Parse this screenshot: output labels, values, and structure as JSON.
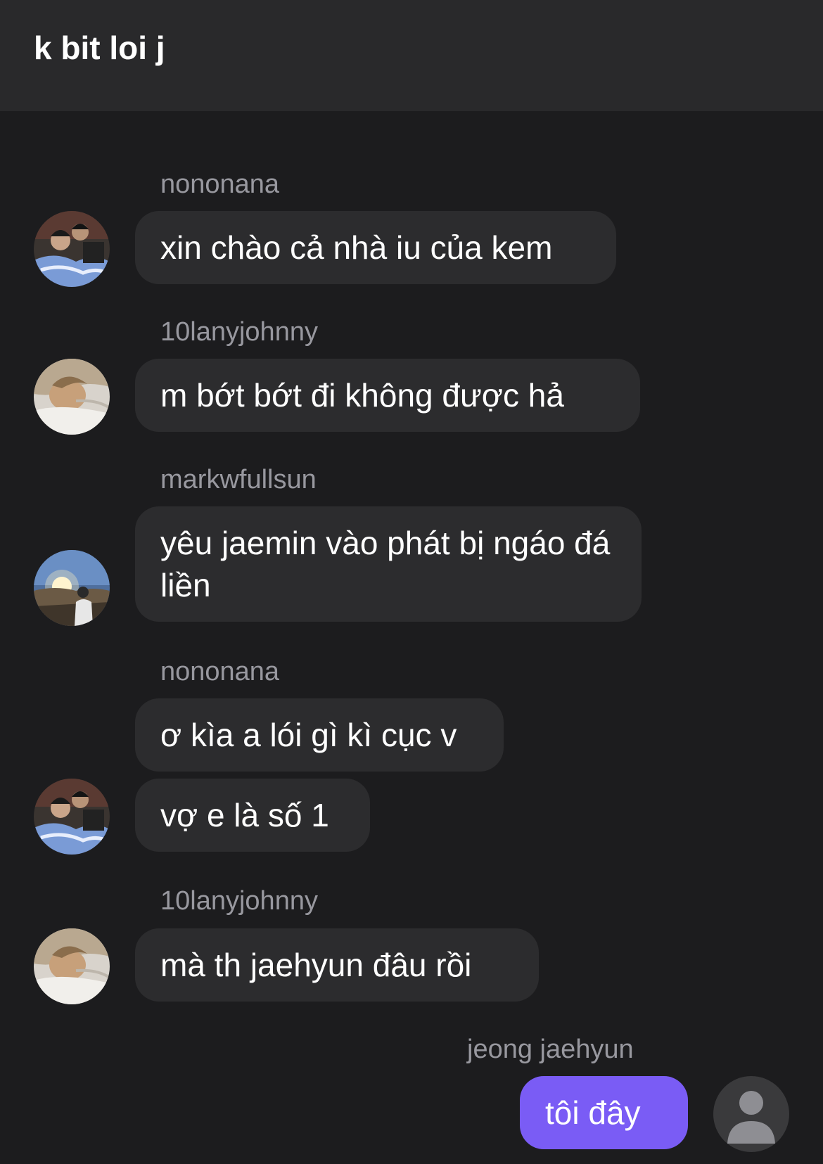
{
  "chat": {
    "title": "k bit loi j"
  },
  "messages": [
    {
      "sender": "nononana",
      "text": "xin chào cả nhà iu của kem"
    },
    {
      "sender": "10lanyjohnny",
      "text": "m bớt bớt đi không được hả"
    },
    {
      "sender": "markwfullsun",
      "text": "yêu jaemin vào phát bị ngáo đá liền"
    },
    {
      "sender": "nononana",
      "texts": [
        "ơ kìa a lói gì kì cục v",
        "vợ e là số 1"
      ]
    },
    {
      "sender": "10lanyjohnny",
      "text": "mà th jaehyun đâu rồi"
    },
    {
      "sender": "jeong jaehyun",
      "text": "tôi đây",
      "mine": true
    }
  ],
  "avatars": {
    "nononana": "photo-avatar-couple",
    "10lanyjohnny": "photo-avatar-sleeping",
    "markwfullsun": "photo-avatar-sunset",
    "jeong jaehyun": "default-person-icon"
  },
  "colors": {
    "background": "#1c1c1e",
    "header": "#29292b",
    "bubble": "#2c2c2e",
    "bubble_mine": "#7a5cf5",
    "username": "#98989f"
  }
}
